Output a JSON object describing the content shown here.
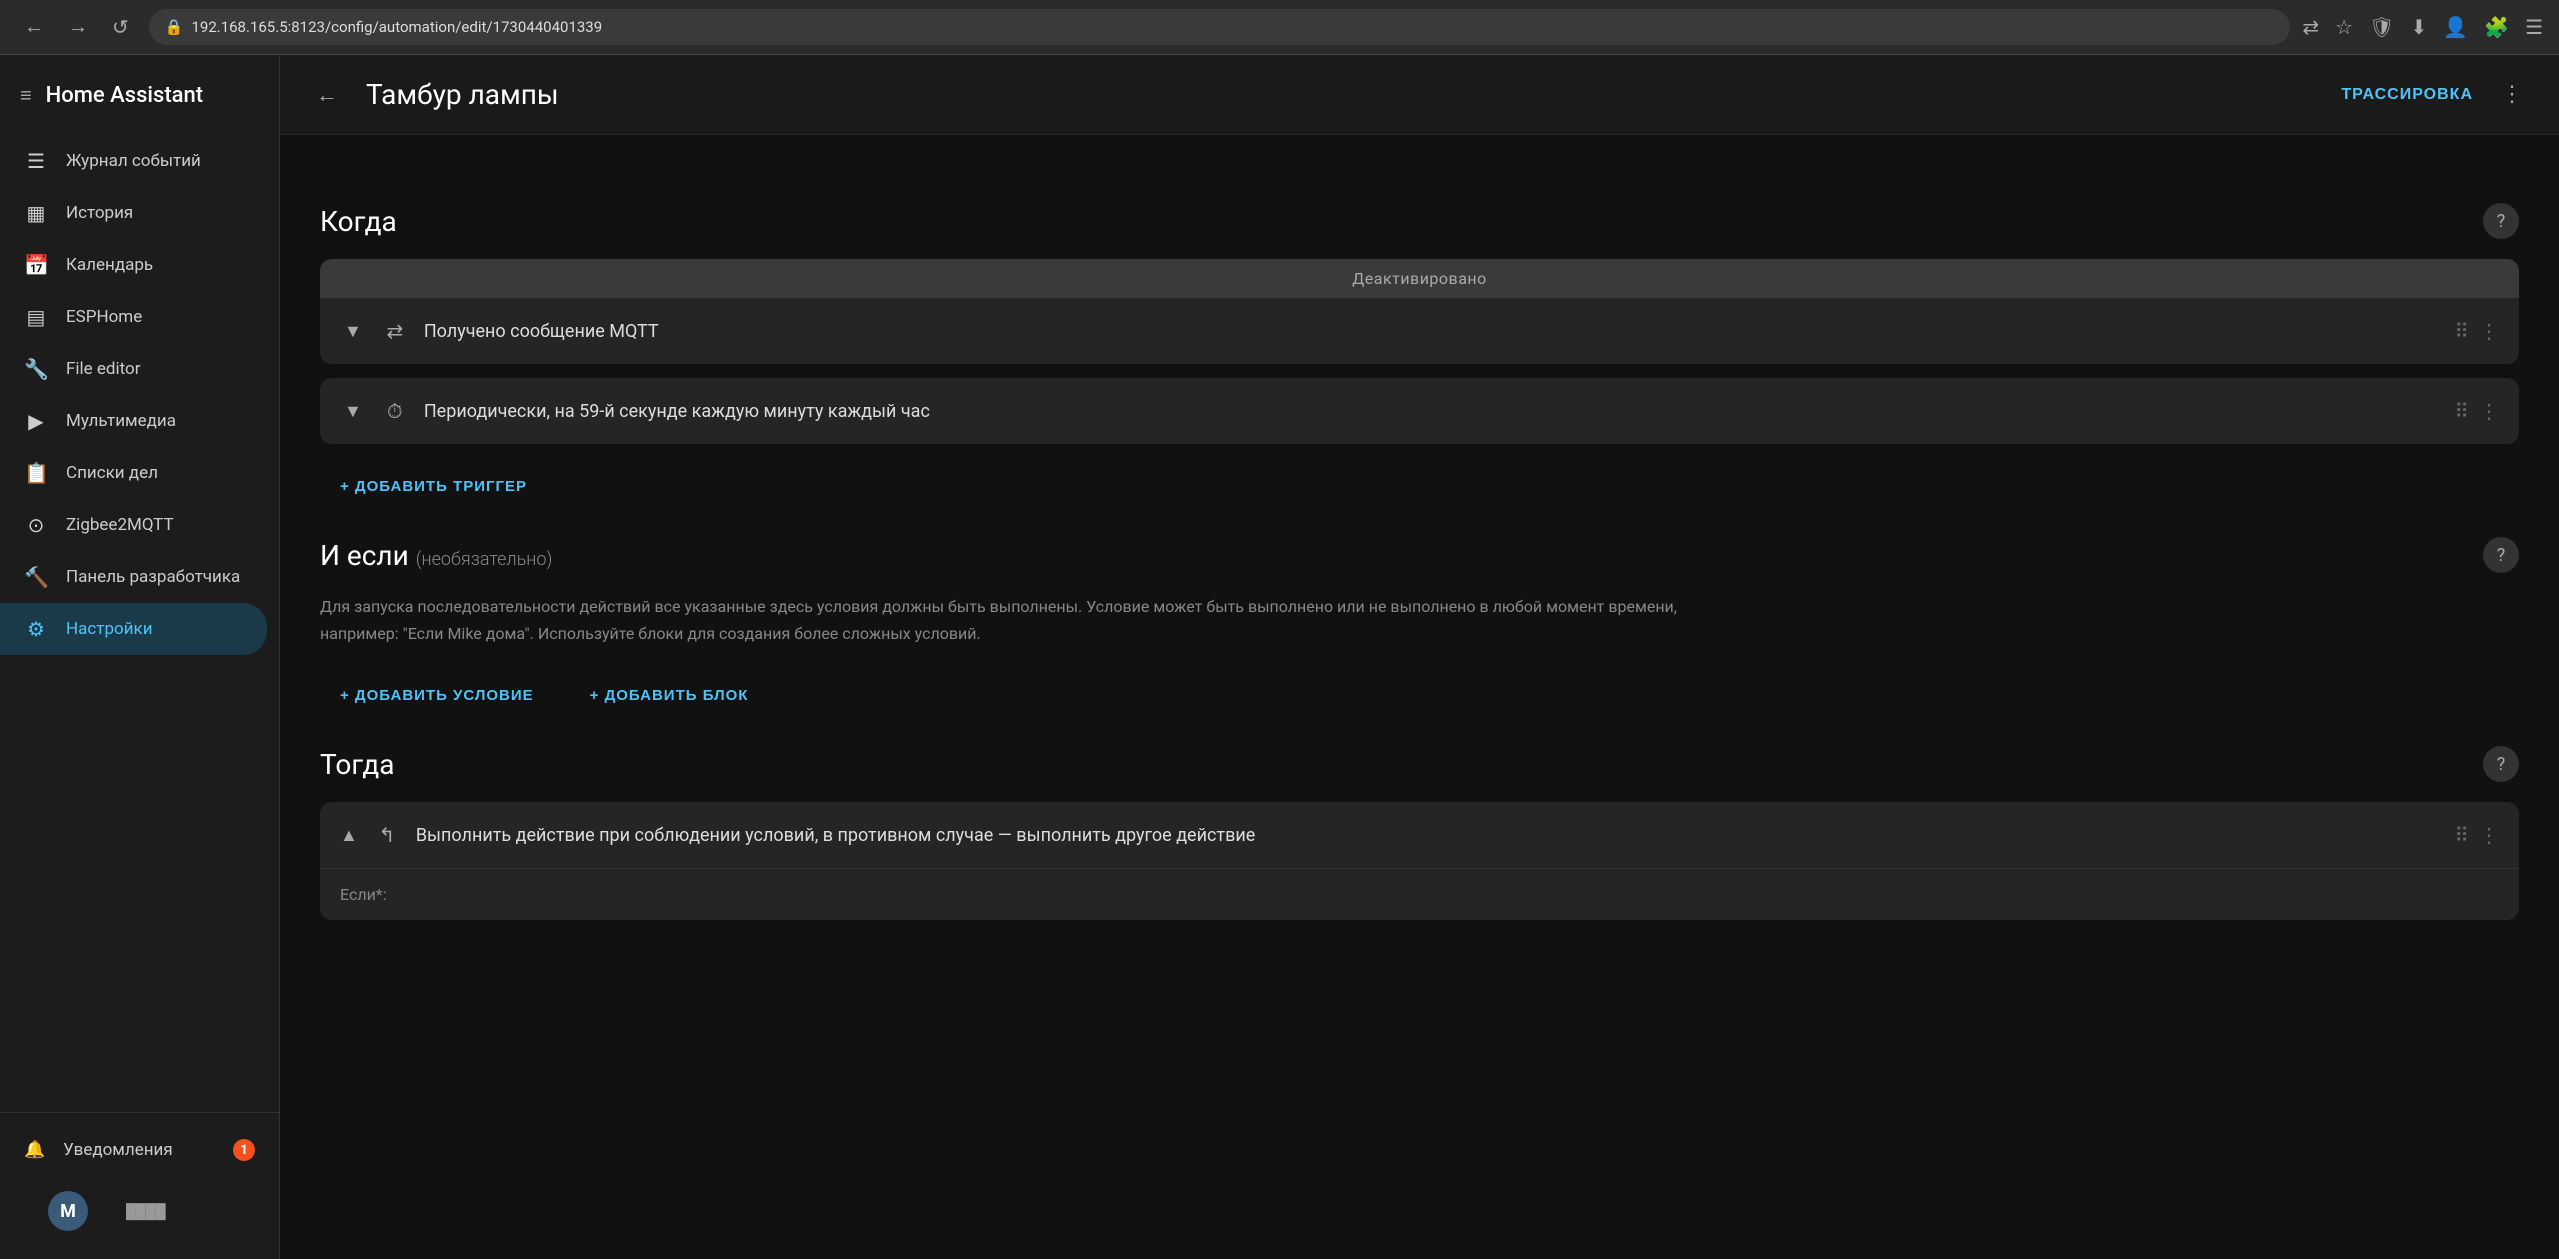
{
  "browser": {
    "back_label": "←",
    "forward_label": "→",
    "reload_label": "↺",
    "url": "192.168.165.5:8123/config/automation/edit/1730440401339",
    "lock_icon": "🔒"
  },
  "sidebar": {
    "title": "Home Assistant",
    "hamburger": "≡",
    "items": [
      {
        "id": "journal",
        "label": "Журнал событий",
        "icon": "☰"
      },
      {
        "id": "history",
        "label": "История",
        "icon": "▦"
      },
      {
        "id": "calendar",
        "label": "Календарь",
        "icon": "📅"
      },
      {
        "id": "esphome",
        "label": "ESPHome",
        "icon": "▤"
      },
      {
        "id": "file-editor",
        "label": "File editor",
        "icon": "🔧"
      },
      {
        "id": "media",
        "label": "Мультимедиа",
        "icon": "▶"
      },
      {
        "id": "todo",
        "label": "Списки дел",
        "icon": "📋"
      },
      {
        "id": "zigbee",
        "label": "Zigbee2MQTT",
        "icon": "⊙"
      },
      {
        "id": "developer",
        "label": "Панель разработчика",
        "icon": "🔨"
      },
      {
        "id": "settings",
        "label": "Настройки",
        "icon": "⚙",
        "active": true
      }
    ],
    "notifications": {
      "label": "Уведомления",
      "icon": "🔔",
      "badge": "1"
    },
    "user": {
      "avatar_letter": "M",
      "info_text": "████"
    }
  },
  "main": {
    "header": {
      "back_label": "←",
      "title": "Тамбур лампы",
      "trace_label": "ТРАССИРОВКА",
      "more_label": "⋮"
    },
    "when": {
      "title": "Когда",
      "deactivated_label": "Деактивировано",
      "triggers": [
        {
          "label": "Получено сообщение MQTT",
          "icon": "⇄"
        },
        {
          "label": "Периодически, на 59-й секунде каждую минуту каждый час",
          "icon": "⏱"
        }
      ],
      "add_trigger_label": "+ ДОБАВИТЬ ТРИГГЕР"
    },
    "if": {
      "title": "И если",
      "optional_label": "(необязательно)",
      "description": "Для запуска последовательности действий все указанные здесь условия должны быть выполнены. Условие может быть выполнено или не выполнено в любой момент времени, например: \"Если Mike дома\". Используйте блоки для создания более сложных условий.",
      "add_condition_label": "+ ДОБАВИТЬ УСЛОВИЕ",
      "add_block_label": "+ ДОБАВИТЬ БЛОК"
    },
    "then": {
      "title": "Тогда",
      "actions": [
        {
          "label": "Выполнить действие при соблюдении условий, в противном случае — выполнить другое действие",
          "icon": "↰",
          "expanded": true
        }
      ],
      "if_label": "Если*:"
    }
  }
}
